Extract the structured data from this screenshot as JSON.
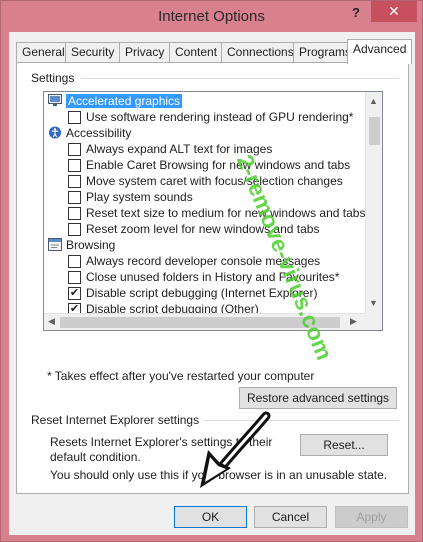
{
  "window": {
    "title": "Internet Options",
    "help": "?",
    "close": "✕"
  },
  "tabs": [
    {
      "label": "General"
    },
    {
      "label": "Security"
    },
    {
      "label": "Privacy"
    },
    {
      "label": "Content"
    },
    {
      "label": "Connections"
    },
    {
      "label": "Programs"
    },
    {
      "label": "Advanced"
    }
  ],
  "settings": {
    "group_label": "Settings",
    "items": [
      {
        "type": "category",
        "icon": "monitor-icon",
        "label": "Accelerated graphics",
        "selected": true
      },
      {
        "type": "checkbox",
        "label": "Use software rendering instead of GPU rendering*",
        "checked": false
      },
      {
        "type": "category",
        "icon": "accessibility-icon",
        "label": "Accessibility",
        "selected": false
      },
      {
        "type": "checkbox",
        "label": "Always expand ALT text for images",
        "checked": false
      },
      {
        "type": "checkbox",
        "label": "Enable Caret Browsing for new windows and tabs",
        "checked": false
      },
      {
        "type": "checkbox",
        "label": "Move system caret with focus/selection changes",
        "checked": false
      },
      {
        "type": "checkbox",
        "label": "Play system sounds",
        "checked": false
      },
      {
        "type": "checkbox",
        "label": "Reset text size to medium for new windows and tabs",
        "checked": false
      },
      {
        "type": "checkbox",
        "label": "Reset zoom level for new windows and tabs",
        "checked": false
      },
      {
        "type": "category",
        "icon": "browsing-icon",
        "label": "Browsing",
        "selected": false
      },
      {
        "type": "checkbox",
        "label": "Always record developer console messages",
        "checked": false
      },
      {
        "type": "checkbox",
        "label": "Close unused folders in History and Favourites*",
        "checked": false
      },
      {
        "type": "checkbox",
        "label": "Disable script debugging (Internet Explorer)",
        "checked": true
      },
      {
        "type": "checkbox",
        "label": "Disable script debugging (Other)",
        "checked": true
      }
    ],
    "note": "* Takes effect after you've restarted your computer",
    "restore_button": "Restore advanced settings"
  },
  "reset": {
    "group_label": "Reset Internet Explorer settings",
    "description": "Resets Internet Explorer's settings to their default condition.",
    "button": "Reset...",
    "note": "You should only use this if your browser is in an unusable state."
  },
  "buttons": {
    "ok": "OK",
    "cancel": "Cancel",
    "apply": "Apply"
  },
  "watermark": "2-remove-virus.com",
  "colors": {
    "frame": "#d9808f",
    "close_button": "#c7505f",
    "selection": "#3399ff",
    "watermark": "#4ccf2e"
  }
}
